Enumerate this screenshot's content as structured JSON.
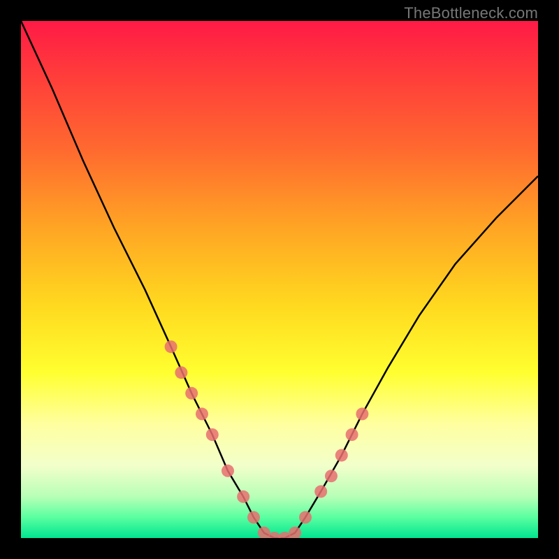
{
  "watermark": "TheBottleneck.com",
  "chart_data": {
    "type": "line",
    "title": "",
    "xlabel": "",
    "ylabel": "",
    "xlim": [
      0,
      100
    ],
    "ylim": [
      0,
      100
    ],
    "background_gradient": {
      "top": "#ff1a46",
      "upper_mid": "#ffa524",
      "mid": "#ffff30",
      "lower_mid": "#b7ffb7",
      "bottom": "#00e58f"
    },
    "series": [
      {
        "name": "bottleneck-curve",
        "type": "line",
        "color": "#000000",
        "x": [
          0,
          6,
          12,
          18,
          24,
          29,
          33,
          37,
          40,
          43,
          45,
          47,
          49,
          51,
          53,
          55,
          58,
          62,
          66,
          71,
          77,
          84,
          92,
          100
        ],
        "y": [
          100,
          87,
          73,
          60,
          48,
          37,
          28,
          20,
          13,
          8,
          4,
          1,
          0,
          0,
          1,
          4,
          9,
          16,
          24,
          33,
          43,
          53,
          62,
          70
        ]
      },
      {
        "name": "highlight-points",
        "type": "scatter",
        "color": "#e76f6f",
        "x": [
          29,
          31,
          33,
          35,
          37,
          40,
          43,
          45,
          47,
          49,
          51,
          53,
          55,
          58,
          60,
          62,
          64,
          66
        ],
        "y": [
          37,
          32,
          28,
          24,
          20,
          13,
          8,
          4,
          1,
          0,
          0,
          1,
          4,
          9,
          12,
          16,
          20,
          24
        ]
      }
    ]
  }
}
